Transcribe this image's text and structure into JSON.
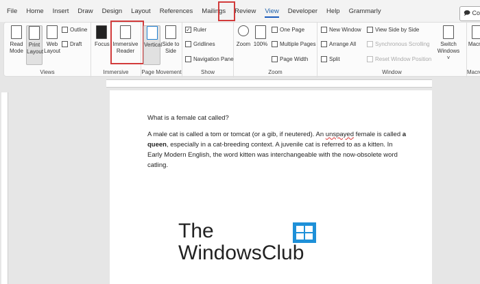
{
  "tabs": [
    "File",
    "Home",
    "Insert",
    "Draw",
    "Design",
    "Layout",
    "References",
    "Mailings",
    "Review",
    "View",
    "Developer",
    "Help",
    "Grammarly"
  ],
  "active_tab": "View",
  "comments_label": "Co",
  "ribbon": {
    "views": {
      "label": "Views",
      "read": "Read Mode",
      "print": "Print Layout",
      "web": "Web Layout",
      "outline": "Outline",
      "draft": "Draft"
    },
    "immersive": {
      "label": "Immersive",
      "focus": "Focus",
      "reader": "Immersive Reader"
    },
    "page_movement": {
      "label": "Page Movement",
      "vertical": "Vertical",
      "side": "Side to Side"
    },
    "show": {
      "label": "Show",
      "ruler": "Ruler",
      "gridlines": "Gridlines",
      "nav": "Navigation Pane"
    },
    "zoom": {
      "label": "Zoom",
      "zoom": "Zoom",
      "pct": "100%",
      "one": "One Page",
      "multi": "Multiple Pages",
      "width": "Page Width"
    },
    "window": {
      "label": "Window",
      "new": "New Window",
      "arrange": "Arrange All",
      "split": "Split",
      "side": "View Side by Side",
      "sync": "Synchronous Scrolling",
      "reset": "Reset Window Position",
      "switch": "Switch Windows ˅"
    },
    "macros": {
      "label": "Macros",
      "btn": "Macros"
    }
  },
  "doc": {
    "heading": "What is a female cat called?",
    "p1a": "A male cat is called a tom or tomcat (or a gib, if neutered). An ",
    "p1err": "unspayed",
    "p1b": " female is called ",
    "p1bold": "a queen",
    "p1c": ", especially in a cat-breeding context. A juvenile cat is referred to as a kitten. In Early Modern English, the word kitten was interchangeable with the now-obsolete word catling."
  },
  "watermark": {
    "line1": "The",
    "line2": "WindowsClub"
  }
}
